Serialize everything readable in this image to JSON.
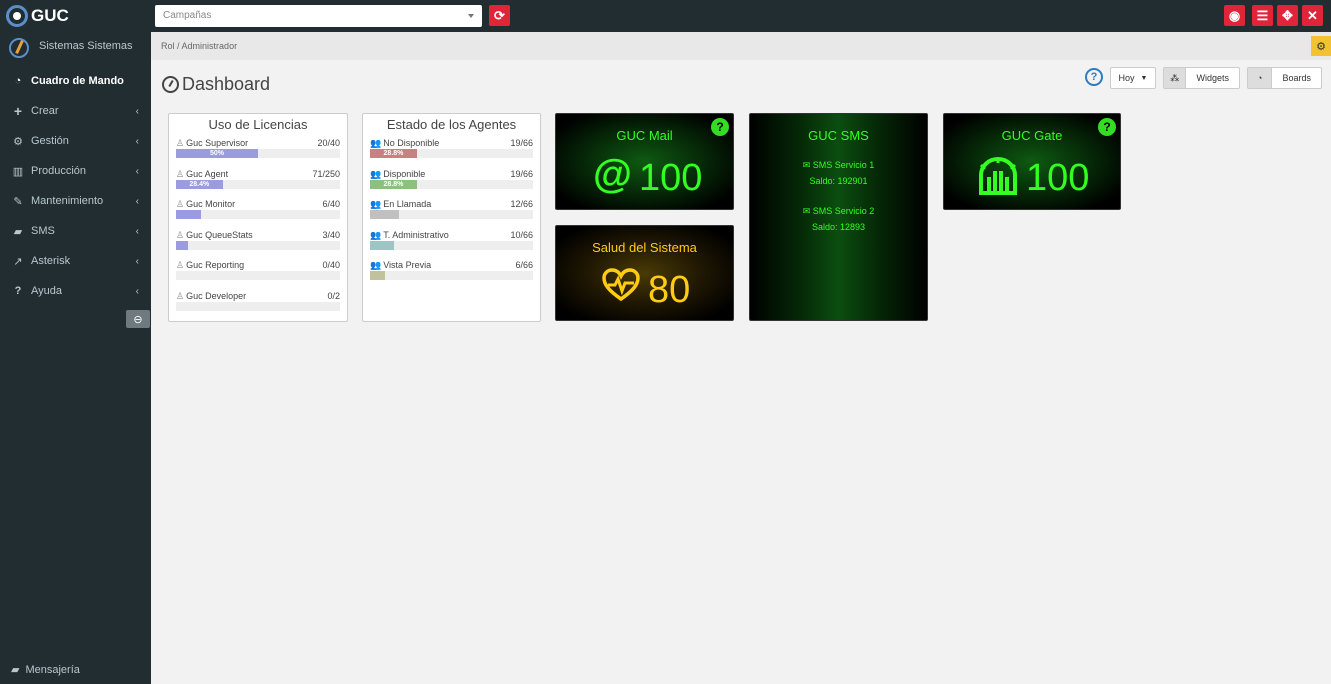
{
  "app": {
    "title": "GUC"
  },
  "topbar": {
    "campaign_placeholder": "Campañas"
  },
  "sidebar": {
    "user": "Sistemas Sistemas",
    "items": [
      {
        "label": "Cuadro de Mando",
        "icon": "dashboard-icon"
      },
      {
        "label": "Crear",
        "icon": "plus-icon"
      },
      {
        "label": "Gestión",
        "icon": "gears-icon"
      },
      {
        "label": "Producción",
        "icon": "bar-chart-icon"
      },
      {
        "label": "Mantenimiento",
        "icon": "wrench-icon"
      },
      {
        "label": "SMS",
        "icon": "chat-icon"
      },
      {
        "label": "Asterisk",
        "icon": "line-chart-icon"
      },
      {
        "label": "Ayuda",
        "icon": "question-icon"
      }
    ],
    "footer": "Mensajería"
  },
  "breadcrumb": {
    "items": [
      "Rol",
      "Administrador"
    ]
  },
  "page": {
    "title": "Dashboard"
  },
  "toolbar": {
    "period": "Hoy",
    "widgets": "Widgets",
    "boards": "Boards"
  },
  "licencias": {
    "title": "Uso de Licencias",
    "color": "#9b9be0",
    "rows": [
      {
        "name": "Guc Supervisor",
        "value": "20/40",
        "fraction": 0.5,
        "label": "50%"
      },
      {
        "name": "Guc Agent",
        "value": "71/250",
        "fraction": 0.284,
        "label": "28.4%"
      },
      {
        "name": "Guc Monitor",
        "value": "6/40",
        "fraction": 0.15,
        "label": ""
      },
      {
        "name": "Guc QueueStats",
        "value": "3/40",
        "fraction": 0.075,
        "label": ""
      },
      {
        "name": "Guc Reporting",
        "value": "0/40",
        "fraction": 0,
        "label": ""
      },
      {
        "name": "Guc Developer",
        "value": "0/2",
        "fraction": 0,
        "label": ""
      }
    ]
  },
  "agentes": {
    "title": "Estado de los Agentes",
    "rows": [
      {
        "name": "No Disponible",
        "value": "19/66",
        "fraction": 0.288,
        "label": "28.8%",
        "color": "#c98080"
      },
      {
        "name": "Disponible",
        "value": "19/66",
        "fraction": 0.288,
        "label": "28.8%",
        "color": "#8cbf80"
      },
      {
        "name": "En Llamada",
        "value": "12/66",
        "fraction": 0.18,
        "label": "",
        "color": "#c0c0c0"
      },
      {
        "name": "T. Administrativo",
        "value": "10/66",
        "fraction": 0.15,
        "label": "",
        "color": "#9cc6c6"
      },
      {
        "name": "Vista Previa",
        "value": "6/66",
        "fraction": 0.09,
        "label": "",
        "color": "#c2c29a"
      }
    ]
  },
  "guc_mail": {
    "title": "GUC Mail",
    "value": "100"
  },
  "salud": {
    "title": "Salud del Sistema",
    "value": "80"
  },
  "guc_sms": {
    "title": "GUC SMS",
    "services": [
      {
        "name": "SMS Servicio 1",
        "saldo": "Saldo: 192901"
      },
      {
        "name": "SMS Servicio 2",
        "saldo": "Saldo: 12893"
      }
    ]
  },
  "guc_gate": {
    "title": "GUC Gate",
    "value": "100"
  }
}
